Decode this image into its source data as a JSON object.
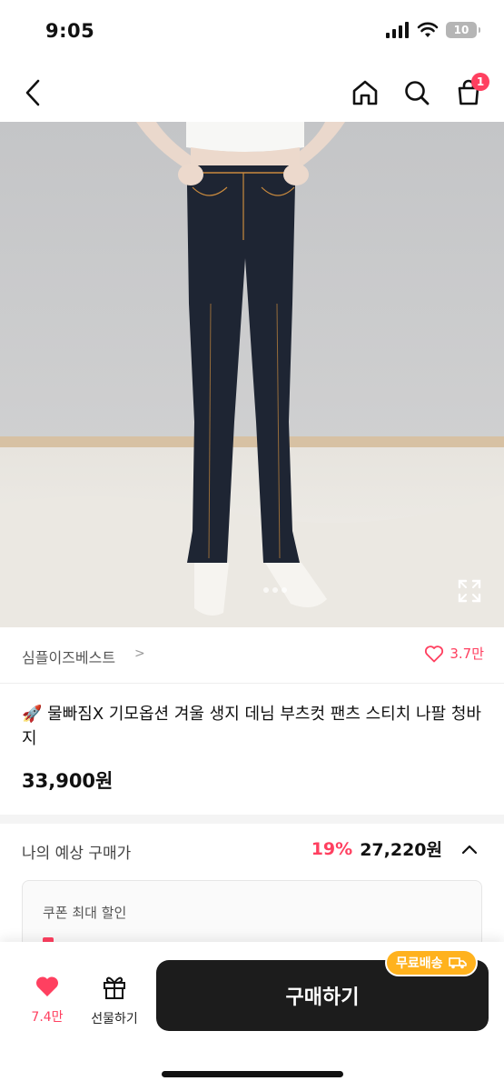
{
  "status": {
    "time": "9:05",
    "battery": "10"
  },
  "nav": {
    "cart_badge": "1"
  },
  "shop": {
    "name": "심플이즈베스트",
    "arrow": ">",
    "likes": "3.7만"
  },
  "product": {
    "title": "🚀 물빠짐X 기모옵션 겨울 생지 데님 부츠컷 팬츠 스티치 나팔 청바지",
    "price": "33,900원"
  },
  "estimate": {
    "label": "나의 예상 구매가",
    "discount": "19%",
    "price": "27,220원"
  },
  "coupon": {
    "title": "쿠폰 최대 할인"
  },
  "bottom": {
    "like_count": "7.4만",
    "gift_label": "선물하기",
    "buy_label": "구매하기",
    "free_shipping": "무료배송"
  },
  "colors": {
    "accent": "#ff4060",
    "dark": "#1c1c1c",
    "ship": "#ffb21e"
  }
}
